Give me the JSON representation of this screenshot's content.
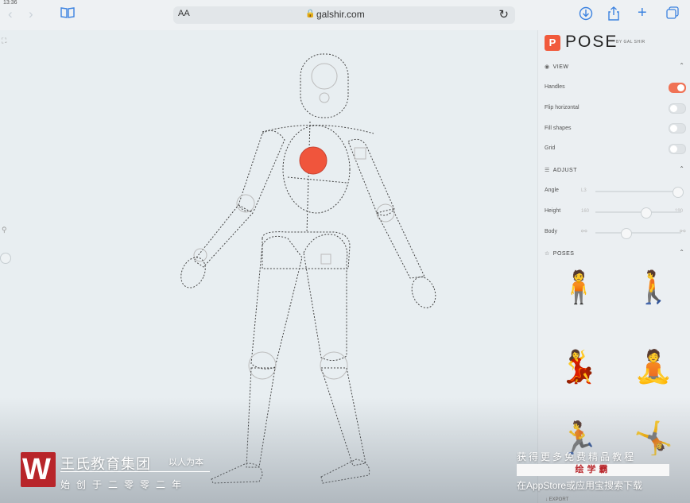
{
  "status_bar": {
    "time": "13:36"
  },
  "browser": {
    "text_size_label": "AA",
    "url": "galshir.com",
    "icons": {
      "back": "chevron-left-icon",
      "forward": "chevron-right-icon",
      "bookmarks": "book-icon",
      "lock": "lock-icon",
      "reload": "reload-icon",
      "download": "download-icon",
      "share": "share-icon",
      "new_tab": "plus-icon",
      "tabs": "tabs-icon"
    }
  },
  "app": {
    "logo_letter": "P",
    "title": "POSE",
    "byline": "BY GAL SHIR",
    "accent": "#f15a3c",
    "view": {
      "label": "VIEW",
      "toggles": [
        {
          "label": "Handles",
          "on": true
        },
        {
          "label": "Flip horizontal",
          "on": false
        },
        {
          "label": "Fill shapes",
          "on": false
        },
        {
          "label": "Grid",
          "on": false
        }
      ]
    },
    "adjust": {
      "label": "ADJUST",
      "sliders": [
        {
          "label": "Angle",
          "min_label": "L3",
          "max_label": "",
          "value": 0.95
        },
        {
          "label": "Height",
          "min_label": "160",
          "max_label": "190",
          "value": 0.58
        },
        {
          "label": "Body",
          "min_label": "",
          "max_label": "",
          "value": 0.35
        }
      ]
    },
    "poses": {
      "label": "POSES"
    },
    "export": {
      "label": "EXPORT"
    }
  },
  "overlay": {
    "brand_name": "王氏教育集团",
    "brand_slogan": "以人为本",
    "brand_sub": "始创于二零零二年",
    "promo_line1": "获得更多免费精品教程",
    "promo_app": "绘学霸",
    "promo_line3": "在AppStore或应用宝搜索下载"
  }
}
